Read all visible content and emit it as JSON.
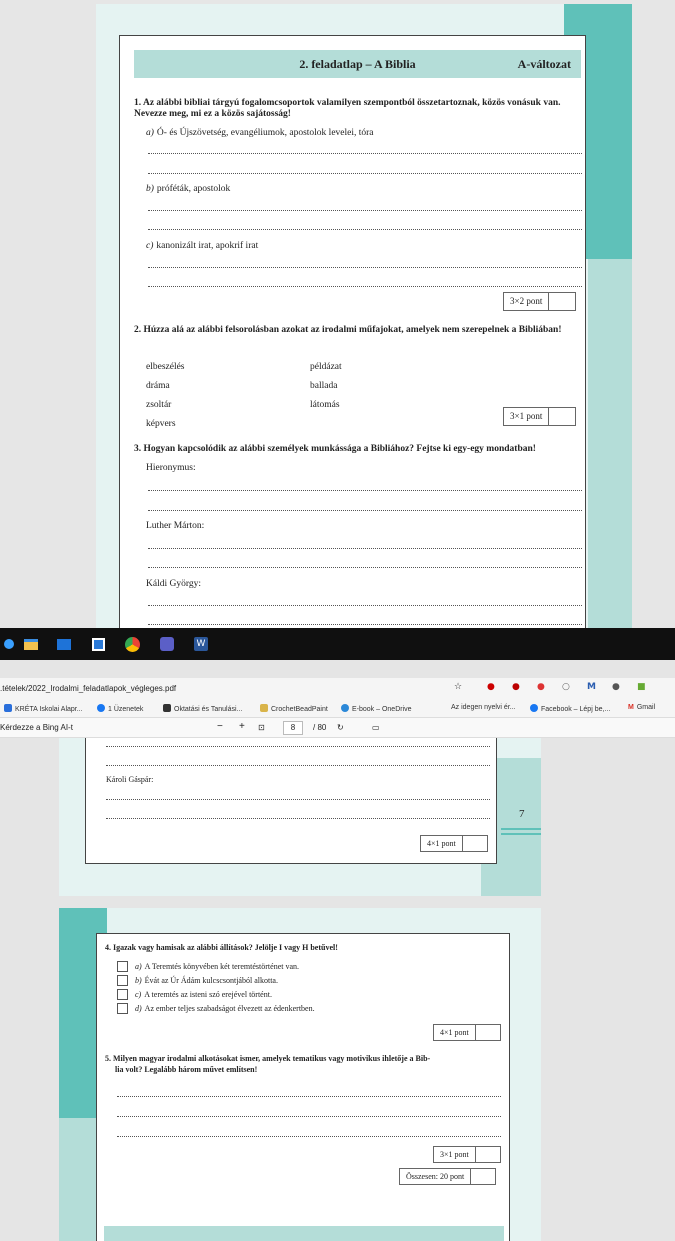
{
  "page_top": {
    "header_title": "2. feladatlap – A Biblia",
    "header_variant": "A-változat",
    "q1": {
      "text": "1. Az alábbi bibliai tárgyú fogalomcsoportok valamilyen szempontból összetartoznak, közös vonásuk van. Nevezze meg, mi ez a közös sajátosság!",
      "items": [
        {
          "letter": "a)",
          "text": "Ó- és Újszövetség, evangéliumok, apostolok levelei, tóra"
        },
        {
          "letter": "b)",
          "text": "próféták, apostolok"
        },
        {
          "letter": "c)",
          "text": "kanonizált irat, apokrif irat"
        }
      ],
      "points": "3×2 pont"
    },
    "q2": {
      "text": "2. Húzza alá az alábbi felsorolásban azokat az irodalmi műfajokat, amelyek nem szerepelnek a Bibliában!",
      "col1": [
        "elbeszélés",
        "dráma",
        "zsoltár",
        "képvers"
      ],
      "col2": [
        "példázat",
        "ballada",
        "látomás"
      ],
      "points": "3×1 pont"
    },
    "q3": {
      "text": "3. Hogyan kapcsolódik az alábbi személyek munkássága a Bibliához? Fejtse ki egy-egy mondatban!",
      "persons": [
        "Hieronymus:",
        "Luther Márton:",
        "Káldi György:"
      ]
    }
  },
  "browser": {
    "url": ".tételek/2022_Irodalmi_feladatlapok_végleges.pdf",
    "bookmarks": [
      {
        "label": "KRÉTA Iskolai Alapr...",
        "color": "#2a6fdb"
      },
      {
        "label": "1 Üzenetek",
        "color": "#1877f2"
      },
      {
        "label": "Oktatási és Tanulási...",
        "color": "#333333"
      },
      {
        "label": "CrochetBeadPaint",
        "color": "#d9b44a"
      },
      {
        "label": "E-book – OneDrive",
        "color": "#2b88d8"
      },
      {
        "label": "Az idegen nyelvi ér...",
        "color": ""
      },
      {
        "label": "Facebook – Lépj be,...",
        "color": "#1877f2"
      },
      {
        "label": "Gmail",
        "color": "#d93025"
      }
    ],
    "ai_prompt": "Kérdezze a Bing AI-t",
    "zoom_minus": "−",
    "zoom_plus": "+",
    "page_current": "8",
    "page_total": "/ 80"
  },
  "page_mid": {
    "person": "Károli Gáspár:",
    "points": "4×1 pont",
    "page_number": "7"
  },
  "page_bottom": {
    "q4": {
      "text": "4. Igazak vagy hamisak az alábbi állítások? Jelölje I vagy H betűvel!",
      "items": [
        {
          "letter": "a)",
          "text": "A Teremtés könyvében két teremtéstörténet van."
        },
        {
          "letter": "b)",
          "text": "Évát az Úr Ádám kulcscsontjából alkotta."
        },
        {
          "letter": "c)",
          "text": "A teremtés az isteni szó erejével történt."
        },
        {
          "letter": "d)",
          "text": "Az ember teljes szabadságot élvezett az édenkertben."
        }
      ],
      "points": "4×1 pont"
    },
    "q5": {
      "text_line1": "5. Milyen magyar irodalmi alkotásokat ismer, amelyek tematikus vagy motivikus ihletője a Bib-",
      "text_line2": "lia volt? Legalább három művet említsen!",
      "points": "3×1 pont"
    },
    "total": "Összesen: 20 pont"
  }
}
